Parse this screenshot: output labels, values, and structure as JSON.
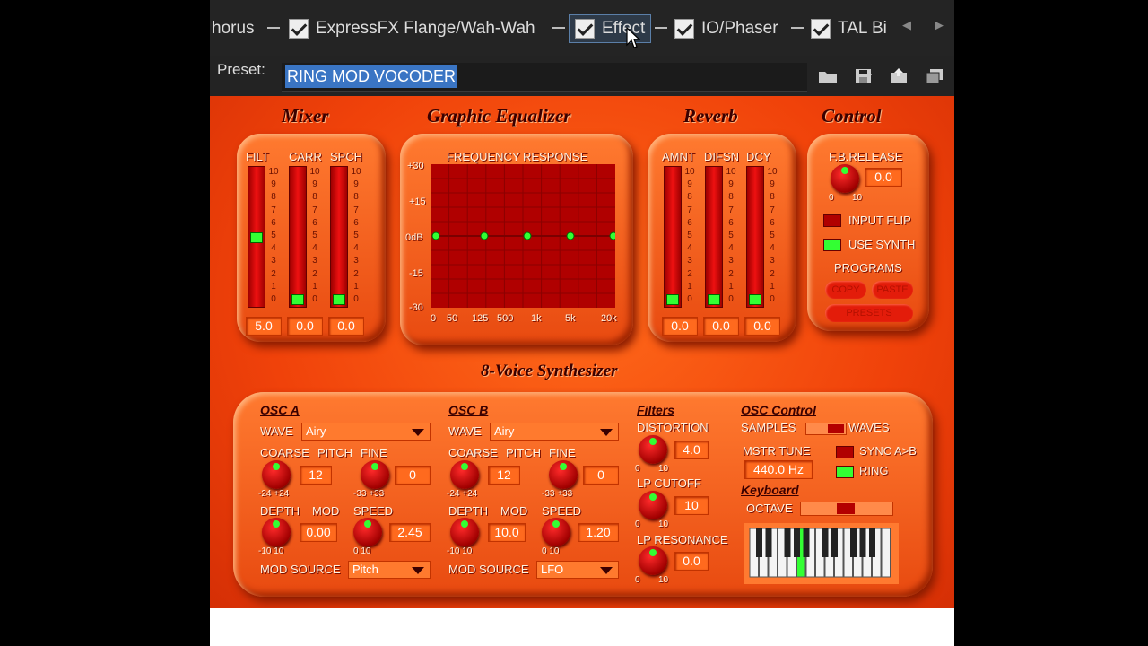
{
  "fx_chain": {
    "items": [
      {
        "label": "horus",
        "checked": false
      },
      {
        "label": "ExpressFX Flange/Wah-Wah",
        "checked": true
      },
      {
        "label": "Effect",
        "checked": true,
        "selected": true
      },
      {
        "label": "IO/Phaser",
        "checked": true
      },
      {
        "label": "TAL Bi",
        "checked": true
      }
    ],
    "nav_prev": "◀",
    "nav_next": "▶"
  },
  "preset": {
    "label": "Preset:",
    "value": "RING MOD VOCODER"
  },
  "plugin": {
    "sections": {
      "mixer": "Mixer",
      "eq": "Graphic Equalizer",
      "reverb": "Reverb",
      "control": "Control",
      "synth": "8-Voice Synthesizer"
    },
    "mixer": {
      "channels": [
        {
          "label": "FILT",
          "value": "5.0",
          "level": 0.5
        },
        {
          "label": "CARR",
          "value": "0.0",
          "level": 0.0
        },
        {
          "label": "SPCH",
          "value": "0.0",
          "level": 0.0
        }
      ],
      "scale": [
        "10",
        "9",
        "8",
        "7",
        "6",
        "5",
        "4",
        "3",
        "2",
        "1",
        "0"
      ]
    },
    "eq": {
      "title": "FREQUENCY RESPONSE",
      "y_labels": [
        "+30",
        "+15",
        "0dB",
        "-15",
        "-30"
      ],
      "x_labels": [
        "0",
        "50",
        "125",
        "500",
        "1k",
        "5k",
        "20k"
      ],
      "band_gains_db": [
        0,
        0,
        0,
        0,
        0
      ]
    },
    "reverb": {
      "channels": [
        {
          "label": "AMNT",
          "value": "0.0",
          "level": 0.0
        },
        {
          "label": "DIFSN",
          "value": "0.0",
          "level": 0.0
        },
        {
          "label": "DCY",
          "value": "0.0",
          "level": 0.0
        }
      ]
    },
    "control": {
      "fb_release_label": "F.B.RELEASE",
      "fb_release_value": "0.0",
      "fb_min": "0",
      "fb_max": "10",
      "input_flip": "INPUT FLIP",
      "input_flip_on": false,
      "use_synth": "USE SYNTH",
      "use_synth_on": true,
      "programs": "PROGRAMS",
      "copy": "COPY",
      "paste": "PASTE",
      "presets": "PRESETS"
    },
    "osc_a": {
      "title": "OSC A",
      "wave_label": "WAVE",
      "wave": "Airy",
      "coarse": "COARSE",
      "pitch": "PITCH",
      "fine": "FINE",
      "pitch_value": "12",
      "fine_value": "0",
      "coarse_range": "-24 +24",
      "fine_range": "-33 +33",
      "depth": "DEPTH",
      "mod": "MOD",
      "speed": "SPEED",
      "depth_value": "0.00",
      "speed_value": "2.45",
      "depth_range": "-10 10",
      "speed_range": "0 10",
      "mod_source_label": "MOD SOURCE",
      "mod_source": "Pitch"
    },
    "osc_b": {
      "title": "OSC B",
      "wave_label": "WAVE",
      "wave": "Airy",
      "coarse": "COARSE",
      "pitch": "PITCH",
      "fine": "FINE",
      "pitch_value": "12",
      "fine_value": "0",
      "coarse_range": "-24 +24",
      "fine_range": "-33 +33",
      "depth": "DEPTH",
      "mod": "MOD",
      "speed": "SPEED",
      "depth_value": "10.0",
      "speed_value": "1.20",
      "depth_range": "-10 10",
      "speed_range": "0 10",
      "mod_source_label": "MOD SOURCE",
      "mod_source": "LFO"
    },
    "filters": {
      "title": "Filters",
      "distortion": "DISTORTION",
      "distortion_value": "4.0",
      "lp_cutoff": "LP CUTOFF",
      "lp_cutoff_value": "10",
      "lp_resonance": "LP RESONANCE",
      "lp_resonance_value": "0.0",
      "range_min": "0",
      "range_max": "10"
    },
    "osc_control": {
      "title": "OSC Control",
      "samples": "SAMPLES",
      "waves": "WAVES",
      "mstr_tune": "MSTR TUNE",
      "mstr_tune_value": "440.0 Hz",
      "sync": "SYNC A>B",
      "ring": "RING",
      "ring_on": true,
      "keyboard": "Keyboard",
      "octave": "OCTAVE"
    }
  }
}
